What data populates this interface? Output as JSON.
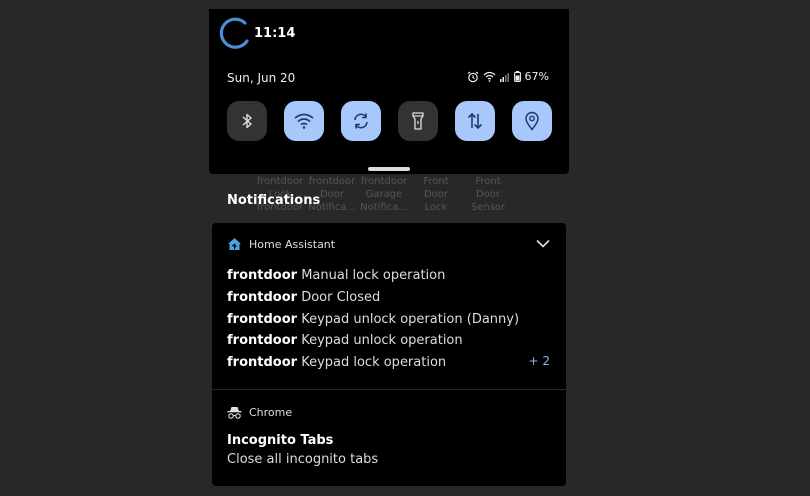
{
  "status_bar": {
    "time": "11:14",
    "date": "Sun, Jun 20",
    "battery": "67%"
  },
  "quick_tiles": [
    {
      "name": "bluetooth",
      "state": "off"
    },
    {
      "name": "wifi",
      "state": "on"
    },
    {
      "name": "auto-rotate",
      "state": "on"
    },
    {
      "name": "flashlight",
      "state": "off"
    },
    {
      "name": "mobile-data",
      "state": "on"
    },
    {
      "name": "location",
      "state": "on"
    }
  ],
  "ghost_labels": [
    [
      "frontdoor",
      "Lock",
      "frontdoor"
    ],
    [
      "frontdoor",
      "Door",
      "Notifica..."
    ],
    [
      "frontdoor",
      "Garage",
      "Notifica..."
    ],
    [
      "Front",
      "Door",
      "Lock"
    ],
    [
      "Front",
      "Door",
      "Sensor"
    ]
  ],
  "notifications": {
    "heading": "Notifications",
    "home_assistant": {
      "app": "Home Assistant",
      "lines": [
        {
          "title": "frontdoor",
          "text": "Manual lock operation"
        },
        {
          "title": "frontdoor",
          "text": "Door Closed"
        },
        {
          "title": "frontdoor",
          "text": "Keypad unlock operation (Danny)"
        },
        {
          "title": "frontdoor",
          "text": "Keypad unlock operation"
        },
        {
          "title": "frontdoor",
          "text": "Keypad lock operation"
        }
      ],
      "more": "+ 2"
    },
    "chrome": {
      "app": "Chrome",
      "title": "Incognito Tabs",
      "text": "Close all incognito tabs"
    }
  },
  "colors": {
    "accent": "#a8c7fa",
    "link": "#8ab4f8",
    "tile_off": "#333333"
  }
}
